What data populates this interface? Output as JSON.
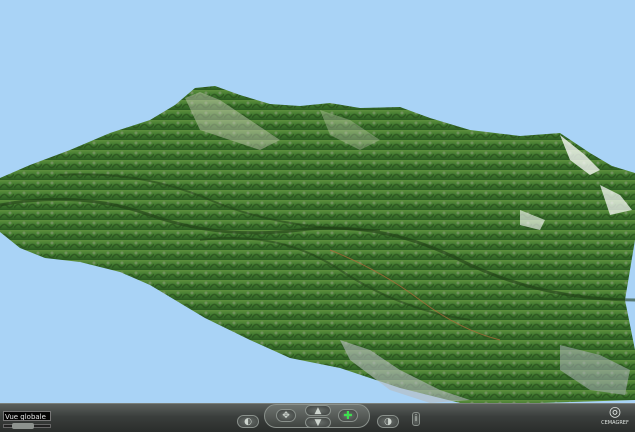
{
  "viewport": {
    "sky_color": "#a9d3f6"
  },
  "toolbar": {
    "view_field_value": "Vue globale",
    "icons": {
      "rotate_left": "rotate-left-icon",
      "pan": "pan-icon",
      "tilt_up": "tilt-up-icon",
      "tilt_down": "tilt-down-icon",
      "zoom": "zoom-icon",
      "rotate_right": "rotate-right-icon",
      "info": "info-icon"
    },
    "accent_color": "#3ee04f"
  },
  "brand": {
    "logo_text": "CEMAGREF"
  }
}
